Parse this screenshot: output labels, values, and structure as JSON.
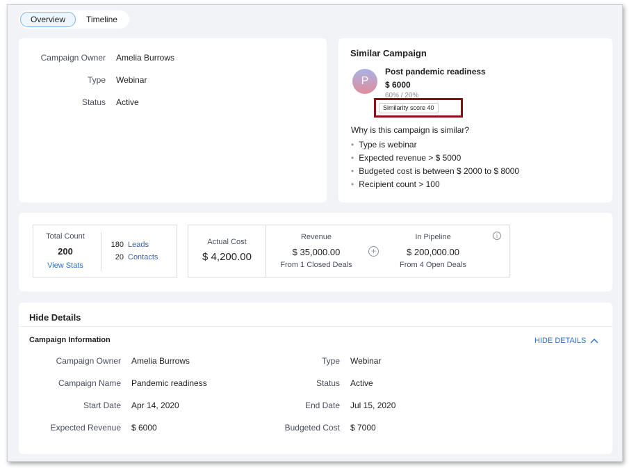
{
  "tabs": [
    {
      "label": "Overview"
    },
    {
      "label": "Timeline"
    }
  ],
  "summary": {
    "rows": [
      {
        "label": "Campaign Owner",
        "value": "Amelia Burrows"
      },
      {
        "label": "Type",
        "value": "Webinar"
      },
      {
        "label": "Status",
        "value": "Active"
      }
    ]
  },
  "similar": {
    "title": "Similar Campaign",
    "avatar_letter": "P",
    "name": "Post pandemic readiness",
    "amount": "$ 6000",
    "percent": "60% / 20%",
    "score": "Similarity score 40",
    "why_title": "Why is this campaign is similar?",
    "reasons": [
      "Type is webinar",
      "Expected revenue > $ 5000",
      "Budgeted cost is between $ 2000 to $ 8000",
      "Recipient count > 100"
    ]
  },
  "metrics": {
    "total_label": "Total Count",
    "total_value": "200",
    "view_stats": "View Stats",
    "leads_count": "180",
    "leads_label": "Leads",
    "contacts_count": "20",
    "contacts_label": "Contacts",
    "actual_cost_label": "Actual Cost",
    "actual_cost_value": "$ 4,200.00",
    "revenue_label": "Revenue",
    "revenue_value": "$ 35,000.00",
    "revenue_sub": "From 1 Closed Deals",
    "pipeline_label": "In Pipeline",
    "pipeline_value": "$ 200,000.00",
    "pipeline_sub": "From 4 Open Deals"
  },
  "details": {
    "hide_title": "Hide Details",
    "section_title": "Campaign Information",
    "hide_link": "HIDE DETAILS",
    "left": [
      {
        "label": "Campaign Owner",
        "value": "Amelia Burrows"
      },
      {
        "label": "Campaign Name",
        "value": "Pandemic readiness"
      },
      {
        "label": "Start Date",
        "value": "Apr 14, 2020"
      },
      {
        "label": "Expected Revenue",
        "value": "$ 6000"
      }
    ],
    "right": [
      {
        "label": "Type",
        "value": "Webinar"
      },
      {
        "label": "Status",
        "value": "Active"
      },
      {
        "label": "End Date",
        "value": "Jul 15, 2020"
      },
      {
        "label": "Budgeted Cost",
        "value": "$ 7000"
      }
    ]
  },
  "colors": {
    "accent": "#2a6dc4",
    "highlight_box": "#8b0f14",
    "background": "#f2f3f7"
  }
}
